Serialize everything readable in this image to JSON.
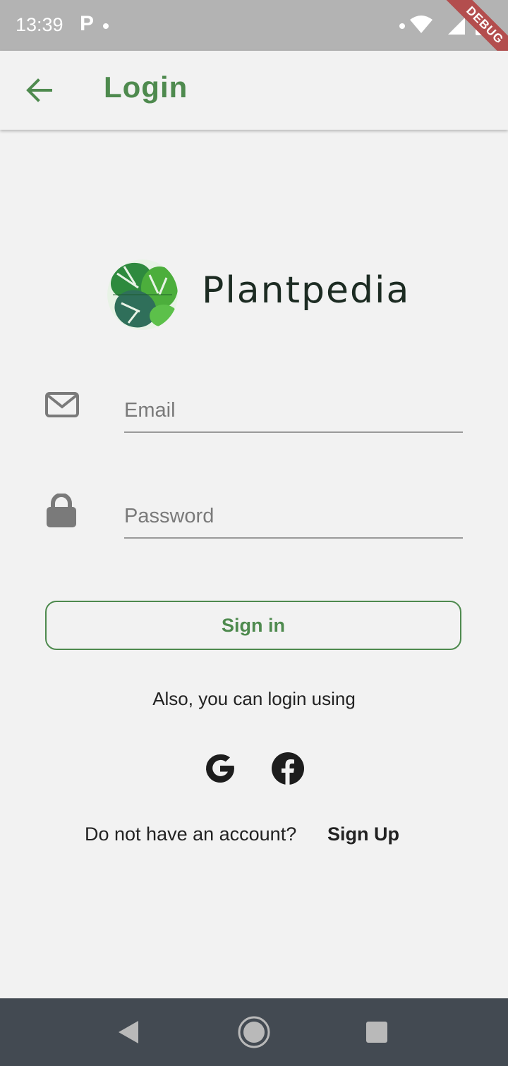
{
  "status_bar": {
    "time": "13:39",
    "notification_icon": "P"
  },
  "debug_banner": "DEBUG",
  "app_bar": {
    "title": "Login",
    "back_icon": "arrow-left-icon"
  },
  "brand": {
    "name": "Plantpedia",
    "logo": "monstera-leaf-logo"
  },
  "form": {
    "email_placeholder": "Email",
    "email_value": "",
    "password_placeholder": "Password",
    "password_value": "",
    "signin_label": "Sign in"
  },
  "social": {
    "prompt": "Also, you can login using",
    "providers": [
      "google-icon",
      "facebook-icon"
    ]
  },
  "signup": {
    "question": "Do not have an account?",
    "link_label": "Sign Up"
  },
  "colors": {
    "accent": "#4e8a4e",
    "background": "#f2f2f2",
    "status_bar": "#b3b3b3",
    "nav_bar": "#434a52"
  }
}
